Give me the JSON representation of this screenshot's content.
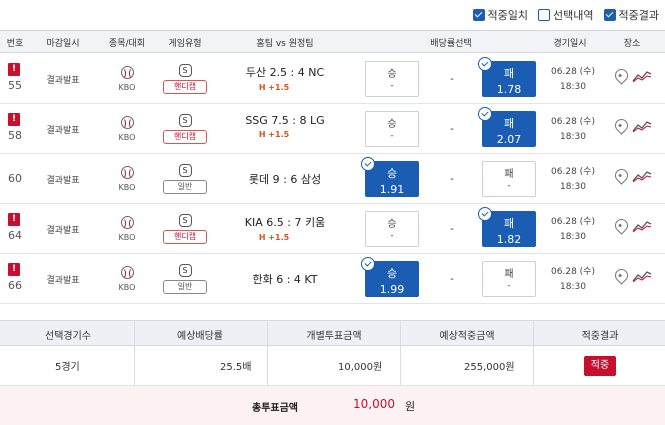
{
  "filters": [
    {
      "label": "적중일치",
      "checked": true
    },
    {
      "label": "선택내역",
      "checked": false
    },
    {
      "label": "적중결과",
      "checked": true
    }
  ],
  "headers": {
    "num": "번호",
    "deadline": "마감일시",
    "league": "종목/대회",
    "type": "게임유형",
    "match": "홈팀 vs 원정팀",
    "bet": "배당률선택",
    "time": "경기일시",
    "venue": "장소"
  },
  "rows": [
    {
      "num": "55",
      "alert": true,
      "status": "결과발표",
      "league": "KBO",
      "type": "핸디캡",
      "type_kind": "hc",
      "home": "두산",
      "home_score": "2.5",
      "away_score": "4",
      "away": "NC",
      "handicap": "H +1.5",
      "home_label": "승",
      "home_odd": "-",
      "draw": "-",
      "away_label": "패",
      "away_odd": "1.78",
      "selected": "away",
      "date": "06.28 (수)",
      "time": "18:30"
    },
    {
      "num": "58",
      "alert": true,
      "status": "결과발표",
      "league": "KBO",
      "type": "핸디캡",
      "type_kind": "hc",
      "home": "SSG",
      "home_score": "7.5",
      "away_score": "8",
      "away": "LG",
      "handicap": "H +1.5",
      "home_label": "승",
      "home_odd": "-",
      "draw": "-",
      "away_label": "패",
      "away_odd": "2.07",
      "selected": "away",
      "date": "06.28 (수)",
      "time": "18:30"
    },
    {
      "num": "60",
      "alert": false,
      "status": "결과발표",
      "league": "KBO",
      "type": "일반",
      "type_kind": "gen",
      "home": "롯데",
      "home_score": "9",
      "away_score": "6",
      "away": "삼성",
      "handicap": "",
      "home_label": "승",
      "home_odd": "1.91",
      "draw": "-",
      "away_label": "패",
      "away_odd": "-",
      "selected": "home",
      "date": "06.28 (수)",
      "time": "18:30"
    },
    {
      "num": "64",
      "alert": true,
      "status": "결과발표",
      "league": "KBO",
      "type": "핸디캡",
      "type_kind": "hc",
      "home": "KIA",
      "home_score": "6.5",
      "away_score": "7",
      "away": "키움",
      "handicap": "H +1.5",
      "home_label": "승",
      "home_odd": "-",
      "draw": "-",
      "away_label": "패",
      "away_odd": "1.82",
      "selected": "away",
      "date": "06.28 (수)",
      "time": "18:30"
    },
    {
      "num": "66",
      "alert": true,
      "status": "결과발표",
      "league": "KBO",
      "type": "일반",
      "type_kind": "gen",
      "home": "한화",
      "home_score": "6",
      "away_score": "4",
      "away": "KT",
      "handicap": "",
      "home_label": "승",
      "home_odd": "1.99",
      "draw": "-",
      "away_label": "패",
      "away_odd": "-",
      "selected": "home",
      "date": "06.28 (수)",
      "time": "18:30"
    }
  ],
  "summary": {
    "headers": {
      "games": "선택경기수",
      "odds": "예상배당률",
      "stake": "개별투표금액",
      "payout": "예상적중금액",
      "result": "적중결과"
    },
    "games": "5경기",
    "odds": "25.5배",
    "stake": "10,000원",
    "payout": "255,000원",
    "result": "적중",
    "total_label": "총투표금액",
    "total_value": "10,000",
    "total_unit": "원"
  },
  "colors": {
    "accent": "#1a5db3",
    "alert": "#c8102e",
    "handicap": "#d9531e"
  }
}
